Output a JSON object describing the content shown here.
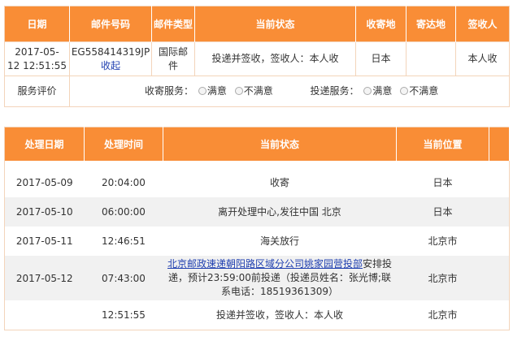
{
  "summary": {
    "headers": [
      "日期",
      "邮件号码",
      "邮件类型",
      "当前状态",
      "收寄地",
      "寄达地",
      "签收人"
    ],
    "row": {
      "date": "2017-05-",
      "time": "12 12:51:55",
      "mail_no": "EG558414319JP",
      "collapse_link": "收起",
      "type_line1": "国际邮",
      "type_line2": "件",
      "status": "投递并签收，签收人：本人收",
      "origin": "日本",
      "destination": "",
      "signer": "本人收"
    },
    "evaluation": {
      "label": "服务评价",
      "pickup_label": "收寄服务：",
      "delivery_label": "投递服务：",
      "satisfied": "满意",
      "unsatisfied": "不满意"
    }
  },
  "tracking": {
    "headers": [
      "处理日期",
      "处理时间",
      "当前状态",
      "当前位置"
    ],
    "rows": [
      {
        "date": "2017-05-09",
        "time": "20:04:00",
        "status": "收寄",
        "location": "日本"
      },
      {
        "date": "2017-05-10",
        "time": "06:00:00",
        "status": "离开处理中心,发往中国 北京",
        "location": "日本"
      },
      {
        "date": "2017-05-11",
        "time": "12:46:51",
        "status": "海关放行",
        "location": "北京市"
      },
      {
        "date": "2017-05-12",
        "time": "07:43:00",
        "status_link": "北京邮政速递朝阳路区域分公司姚家园营投部",
        "status_line1_rest": "安排投",
        "status_line2": "递，预计23:59:00前投递（投递员姓名：张光博;联",
        "status_line3": "系电话：18519361309）",
        "location": "北京市"
      },
      {
        "date": "",
        "time": "12:51:55",
        "status": "投递并签收，签收人：本人收",
        "location": "北京市"
      }
    ]
  },
  "colors": {
    "header_bg": "#f98d36",
    "header_text": "#ffffff",
    "link": "#1f3fb0",
    "stripe": "#f1f1f1"
  }
}
